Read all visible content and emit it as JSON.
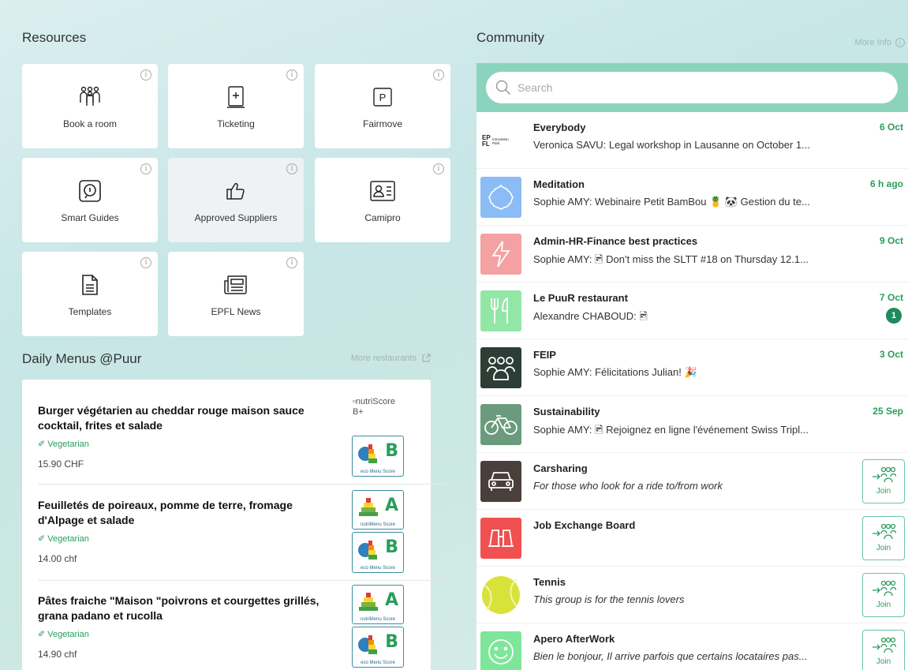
{
  "resources": {
    "title": "Resources",
    "tiles": [
      {
        "label": "Book a room",
        "icon": "people-group-icon"
      },
      {
        "label": "Ticketing",
        "icon": "ticket-plus-icon"
      },
      {
        "label": "Fairmove",
        "icon": "parking-icon"
      },
      {
        "label": "Smart Guides",
        "icon": "guide-info-icon"
      },
      {
        "label": "Approved Suppliers",
        "icon": "thumbs-up-icon"
      },
      {
        "label": "Camipro",
        "icon": "id-card-icon"
      },
      {
        "label": "Templates",
        "icon": "document-icon"
      },
      {
        "label": "EPFL News",
        "icon": "newspaper-icon"
      }
    ],
    "info_glyph": "i"
  },
  "menus": {
    "title": "Daily Menus @Puur",
    "more_link": "More restaurants",
    "items": [
      {
        "dish": "Burger végétarien au cheddar rouge maison sauce cocktail, frites et salade",
        "tag": "Vegetarian",
        "price": "15.90 CHF",
        "nutri_alt": "nutriScore B+",
        "eco": "B"
      },
      {
        "dish": "Feuilletés de poireaux, pomme de terre, fromage d'Alpage et salade",
        "tag": "Vegetarian",
        "price": "14.00 chf",
        "nutri": "A",
        "eco": "B"
      },
      {
        "dish": "Pâtes fraiche \"Maison \"poivrons et courgettes grillés, grana padano et rucolla",
        "tag": "Vegetarian",
        "price": "14.90 chf",
        "nutri": "A",
        "eco": "B"
      }
    ],
    "eco_caption": "eco Menu Score",
    "nutri_caption": "nutriMenu Score"
  },
  "community": {
    "title": "Community",
    "more_info": "More Info",
    "search_placeholder": "Search",
    "join_label": "Join",
    "groups": [
      {
        "name": "Everybody",
        "message": "Veronica SAVU: Legal workshop in Lausanne on October 1...",
        "date": "6 Oct",
        "avatar_text": "EPFL Innovation Park",
        "color": "#ffffff"
      },
      {
        "name": "Meditation",
        "message": "Sophie AMY: Webinaire Petit BamBou 🍍 🐼 Gestion du te...",
        "date": "6 h ago",
        "color": "#8bbcf5"
      },
      {
        "name": "Admin-HR-Finance best practices",
        "message": "Sophie AMY: 🖻 Don't miss the SLTT #18 on Thursday 12.1...",
        "date": "9 Oct",
        "color": "#f3a1a1"
      },
      {
        "name": "Le PuuR restaurant",
        "message": "Alexandre CHABOUD: 🖻",
        "date": "7 Oct",
        "badge": "1",
        "color": "#92e6a6"
      },
      {
        "name": "FEIP",
        "message": "Sophie AMY: Félicitations Julian! 🎉",
        "date": "3 Oct",
        "color": "#2c3e36"
      },
      {
        "name": "Sustainability",
        "message": "Sophie AMY: 🖻 Rejoignez en ligne l'événement Swiss Tripl...",
        "date": "25 Sep",
        "color": "#6a9b7d"
      },
      {
        "name": "Carsharing",
        "message": "For those who look for a ride to/from work",
        "color": "#4a3f3a",
        "join": true
      },
      {
        "name": "Job Exchange Board",
        "message": "",
        "color": "#f05050",
        "join": true
      },
      {
        "name": "Tennis",
        "message": "This group is for the tennis lovers",
        "color": "#d9e23a",
        "join": true
      },
      {
        "name": "Apero AfterWork",
        "message": "Bien le bonjour, Il arrive parfois que certains locataires pas...",
        "color": "#7ee69a",
        "join": true
      }
    ]
  }
}
